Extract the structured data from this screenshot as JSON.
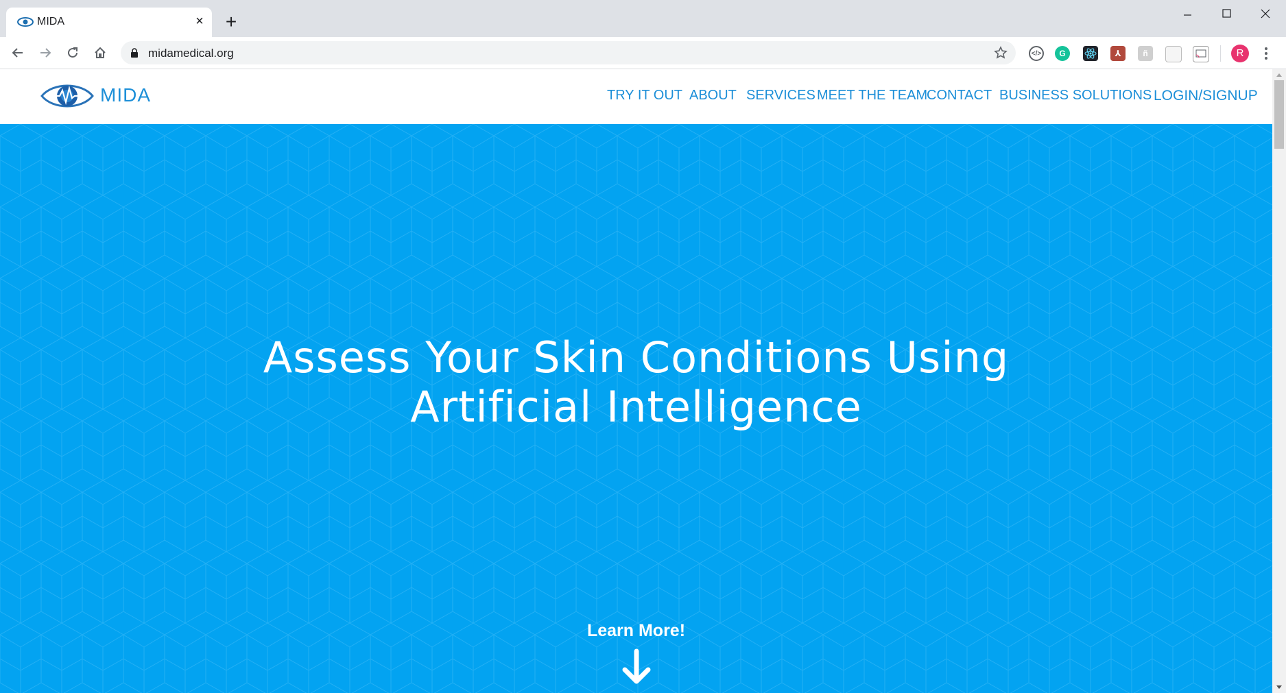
{
  "browser": {
    "tab_title": "MIDA",
    "tab_close": "×",
    "new_tab": "+",
    "url": "midamedical.org",
    "profile_initial": "R"
  },
  "site": {
    "logo_text": "MIDA",
    "nav": [
      "TRY IT OUT",
      "ABOUT",
      "SERVICES",
      "MEET THE TEAM",
      "CONTACT",
      "BUSINESS SOLUTIONS"
    ],
    "login": "LOGIN/SIGNUP"
  },
  "hero": {
    "title_line1": "Assess Your Skin Conditions Using",
    "title_line2": "Artificial Intelligence",
    "learn_more": "Learn More!"
  },
  "colors": {
    "brand": "#1d8fd8",
    "hero_bg": "#03a3f1",
    "avatar": "#e8336e"
  }
}
